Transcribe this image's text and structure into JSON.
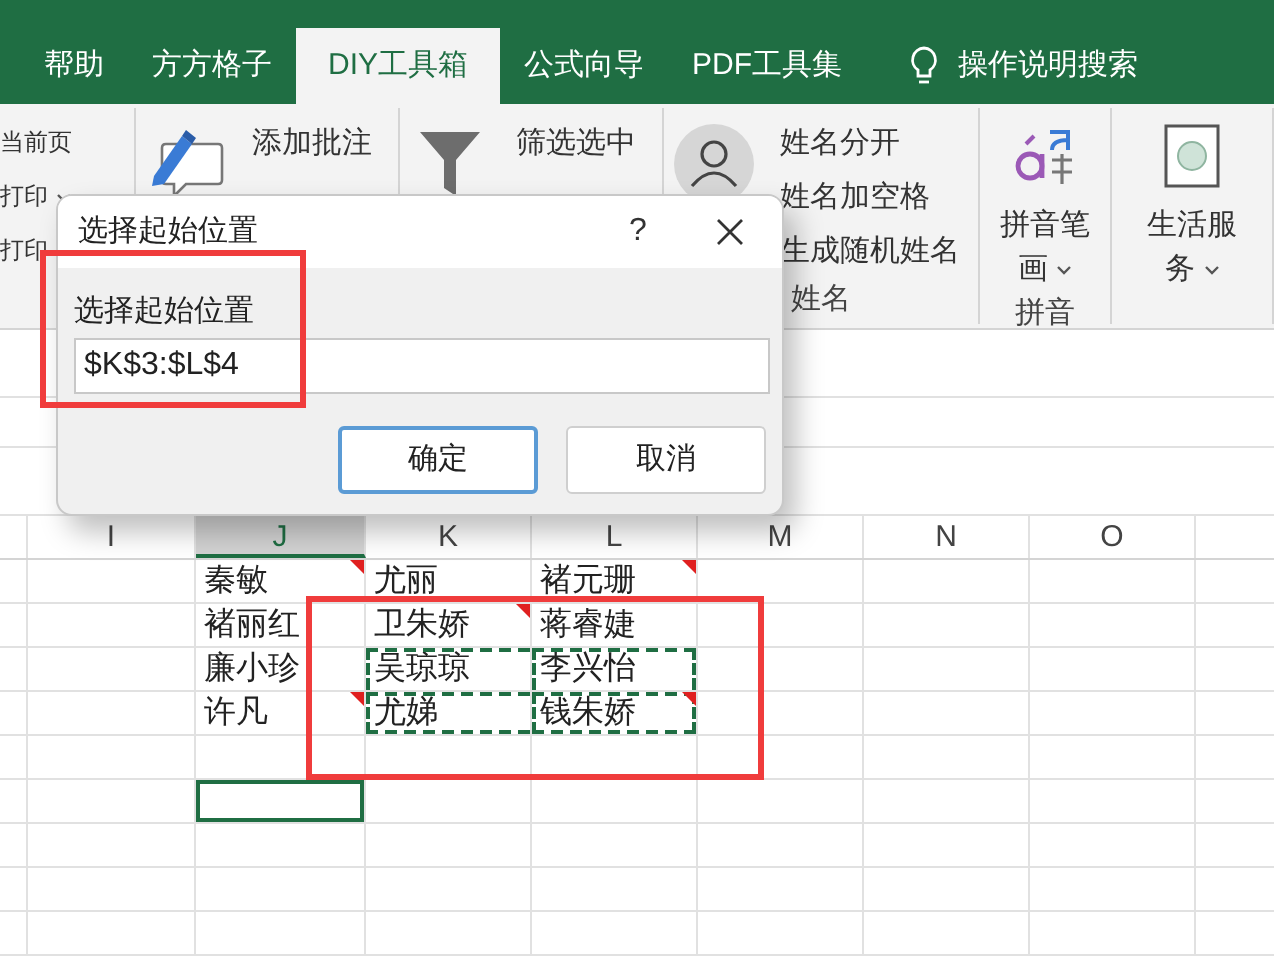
{
  "tabs": [
    {
      "label": "帮助",
      "selected": false
    },
    {
      "label": "方方格子",
      "selected": false
    },
    {
      "label": "DIY工具箱",
      "selected": true
    },
    {
      "label": "公式向导",
      "selected": false
    },
    {
      "label": "PDF工具集",
      "selected": false
    }
  ],
  "tell_me": {
    "label": "操作说明搜索"
  },
  "ribbon": {
    "groups": [
      {
        "kind": "print",
        "items": [
          {
            "label": "当前页",
            "dropdown": false
          },
          {
            "label": "打印",
            "dropdown": true
          },
          {
            "label": "打印",
            "dropdown": false
          }
        ]
      },
      {
        "kind": "comment",
        "items": [
          {
            "label": "添加批注"
          }
        ]
      },
      {
        "kind": "filter",
        "items": [
          {
            "label": "筛选选中"
          }
        ]
      },
      {
        "kind": "name",
        "items": [
          {
            "label": "姓名分开"
          },
          {
            "label": "姓名加空格"
          },
          {
            "label": "生成随机姓名"
          }
        ],
        "label": "姓名"
      },
      {
        "kind": "pinyin",
        "button": "拼音笔画",
        "dropdown": true,
        "label": "拼音"
      },
      {
        "kind": "service",
        "button": "生活服务",
        "dropdown": true
      }
    ]
  },
  "dialog": {
    "title": "选择起始位置",
    "help": "?",
    "field_label": "选择起始位置",
    "value": "$K$3:$L$4",
    "buttons": [
      {
        "label": "确定",
        "default": true
      },
      {
        "label": "取消",
        "default": false
      }
    ]
  },
  "sheet": {
    "columns": [
      {
        "label": "I",
        "selected": false
      },
      {
        "label": "J",
        "selected": true
      },
      {
        "label": "K",
        "selected": false
      },
      {
        "label": "L",
        "selected": false
      },
      {
        "label": "M",
        "selected": false
      },
      {
        "label": "N",
        "selected": false
      },
      {
        "label": "O",
        "selected": false
      }
    ],
    "rows": [
      {
        "cells": [
          {
            "comment": false,
            "copied": false,
            "selected": false
          },
          {
            "text": "秦敏",
            "comment": true,
            "copied": false,
            "selected": false
          },
          {
            "text": "尤丽",
            "comment": false,
            "copied": false,
            "selected": false
          },
          {
            "text": "褚元珊",
            "comment": true,
            "copied": false,
            "selected": false
          },
          {
            "comment": false,
            "copied": false,
            "selected": false
          },
          {
            "comment": false,
            "copied": false,
            "selected": false
          },
          {
            "comment": false,
            "copied": false,
            "selected": false
          }
        ]
      },
      {
        "cells": [
          {
            "comment": false,
            "copied": false,
            "selected": false
          },
          {
            "text": "褚丽红",
            "comment": false,
            "copied": false,
            "selected": false
          },
          {
            "text": "卫朱娇",
            "comment": true,
            "copied": false,
            "selected": false
          },
          {
            "text": "蒋睿婕",
            "comment": false,
            "copied": false,
            "selected": false
          },
          {
            "comment": false,
            "copied": false,
            "selected": false
          },
          {
            "comment": false,
            "copied": false,
            "selected": false
          },
          {
            "comment": false,
            "copied": false,
            "selected": false
          }
        ]
      },
      {
        "cells": [
          {
            "comment": false,
            "copied": false,
            "selected": false
          },
          {
            "text": "廉小珍",
            "comment": false,
            "copied": false,
            "selected": false
          },
          {
            "text": "吴琼琼",
            "comment": false,
            "copied": true,
            "selected": false
          },
          {
            "text": "李兴怡",
            "comment": false,
            "copied": true,
            "selected": false
          },
          {
            "comment": false,
            "copied": false,
            "selected": false
          },
          {
            "comment": false,
            "copied": false,
            "selected": false
          },
          {
            "comment": false,
            "copied": false,
            "selected": false
          }
        ]
      },
      {
        "cells": [
          {
            "comment": false,
            "copied": false,
            "selected": false
          },
          {
            "text": "许凡",
            "comment": true,
            "copied": false,
            "selected": false
          },
          {
            "text": "尤娣",
            "comment": false,
            "copied": true,
            "selected": false
          },
          {
            "text": "钱朱娇",
            "comment": true,
            "copied": true,
            "selected": false
          },
          {
            "comment": false,
            "copied": false,
            "selected": false
          },
          {
            "comment": false,
            "copied": false,
            "selected": false
          },
          {
            "comment": false,
            "copied": false,
            "selected": false
          }
        ]
      },
      {
        "cells": [
          {
            "comment": false,
            "copied": false,
            "selected": false
          },
          {
            "comment": false,
            "copied": false,
            "selected": false
          },
          {
            "comment": false,
            "copied": false,
            "selected": false
          },
          {
            "comment": false,
            "copied": false,
            "selected": false
          },
          {
            "comment": false,
            "copied": false,
            "selected": false
          },
          {
            "comment": false,
            "copied": false,
            "selected": false
          },
          {
            "comment": false,
            "copied": false,
            "selected": false
          }
        ]
      },
      {
        "cells": [
          {
            "comment": false,
            "copied": false,
            "selected": false
          },
          {
            "comment": false,
            "copied": false,
            "selected": true
          },
          {
            "comment": false,
            "copied": false,
            "selected": false
          },
          {
            "comment": false,
            "copied": false,
            "selected": false
          },
          {
            "comment": false,
            "copied": false,
            "selected": false
          },
          {
            "comment": false,
            "copied": false,
            "selected": false
          },
          {
            "comment": false,
            "copied": false,
            "selected": false
          }
        ]
      },
      {
        "cells": [
          {
            "comment": false,
            "copied": false,
            "selected": false
          },
          {
            "comment": false,
            "copied": false,
            "selected": false
          },
          {
            "comment": false,
            "copied": false,
            "selected": false
          },
          {
            "comment": false,
            "copied": false,
            "selected": false
          },
          {
            "comment": false,
            "copied": false,
            "selected": false
          },
          {
            "comment": false,
            "copied": false,
            "selected": false
          },
          {
            "comment": false,
            "copied": false,
            "selected": false
          }
        ]
      },
      {
        "cells": [
          {
            "comment": false,
            "copied": false,
            "selected": false
          },
          {
            "comment": false,
            "copied": false,
            "selected": false
          },
          {
            "comment": false,
            "copied": false,
            "selected": false
          },
          {
            "comment": false,
            "copied": false,
            "selected": false
          },
          {
            "comment": false,
            "copied": false,
            "selected": false
          },
          {
            "comment": false,
            "copied": false,
            "selected": false
          },
          {
            "comment": false,
            "copied": false,
            "selected": false
          }
        ]
      },
      {
        "cells": [
          {
            "comment": false,
            "copied": false,
            "selected": false
          },
          {
            "comment": false,
            "copied": false,
            "selected": false
          },
          {
            "comment": false,
            "copied": false,
            "selected": false
          },
          {
            "comment": false,
            "copied": false,
            "selected": false
          },
          {
            "comment": false,
            "copied": false,
            "selected": false
          },
          {
            "comment": false,
            "copied": false,
            "selected": false
          },
          {
            "comment": false,
            "copied": false,
            "selected": false
          }
        ]
      }
    ]
  }
}
